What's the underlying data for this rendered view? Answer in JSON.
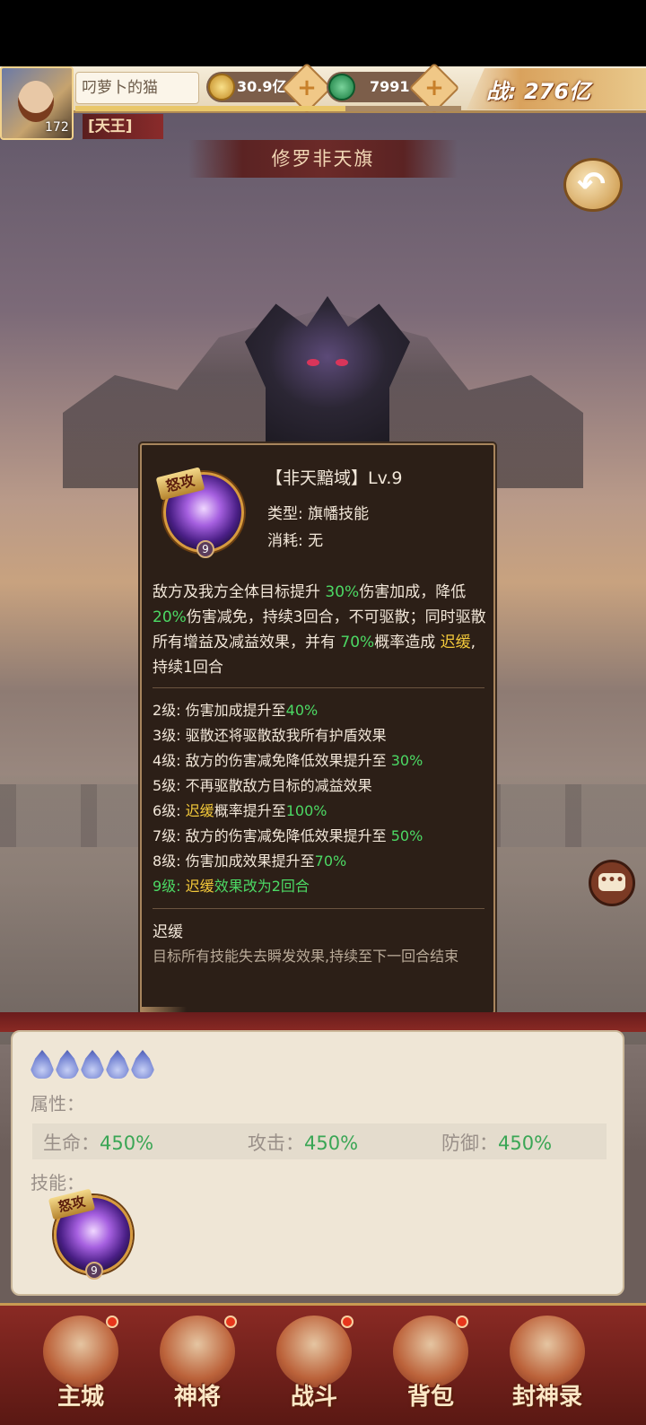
{
  "header": {
    "player_name": "叼萝卜的猫",
    "level": "172",
    "currency": [
      {
        "icon": "coin-icon",
        "value": "30.9亿"
      },
      {
        "icon": "jade-icon",
        "value": "7991"
      }
    ],
    "power": "战: 276亿",
    "rank": "[天王]",
    "exp_fraction": 0.7
  },
  "page_title": "修罗非天旗",
  "tooltip": {
    "badge": "怒攻",
    "skill_level_badge": "9",
    "name": "【非天黯域】Lv.9",
    "type": "类型: 旗幡技能",
    "cost": "消耗: 无",
    "desc": [
      {
        "t": "敌方及我方全体目标提升 ",
        "c": ""
      },
      {
        "t": "30%",
        "c": "g"
      },
      {
        "t": "伤害加成，降低 ",
        "c": ""
      },
      {
        "t": "20%",
        "c": "g"
      },
      {
        "t": "伤害减免，持续3回合，不可驱散；同时驱散所有增益及减益效果，并有 ",
        "c": ""
      },
      {
        "t": "70%",
        "c": "g"
      },
      {
        "t": "概率造成 ",
        "c": ""
      },
      {
        "t": "迟缓",
        "c": "y"
      },
      {
        "t": ",持续1回合",
        "c": ""
      }
    ],
    "levels": [
      [
        {
          "t": "2级: 伤害加成提升至",
          "c": ""
        },
        {
          "t": "40%",
          "c": "g"
        }
      ],
      [
        {
          "t": "3级: 驱散还将驱散敌我所有护盾效果",
          "c": ""
        }
      ],
      [
        {
          "t": "4级: 敌方的伤害减免降低效果提升至 ",
          "c": ""
        },
        {
          "t": "30%",
          "c": "g"
        }
      ],
      [
        {
          "t": "5级: 不再驱散敌方目标的减益效果",
          "c": ""
        }
      ],
      [
        {
          "t": "6级: ",
          "c": ""
        },
        {
          "t": "迟缓",
          "c": "y"
        },
        {
          "t": "概率提升至",
          "c": ""
        },
        {
          "t": "100%",
          "c": "g"
        }
      ],
      [
        {
          "t": "7级: 敌方的伤害减免降低效果提升至 ",
          "c": ""
        },
        {
          "t": "50%",
          "c": "g"
        }
      ],
      [
        {
          "t": "8级: 伤害加成效果提升至",
          "c": ""
        },
        {
          "t": "70%",
          "c": "g"
        }
      ],
      [
        {
          "t": "9级: ",
          "c": "g"
        },
        {
          "t": "迟缓",
          "c": "y"
        },
        {
          "t": "效果改为2回合",
          "c": "g"
        }
      ]
    ],
    "term": "迟缓",
    "term_desc": "目标所有技能失去瞬发效果,持续至下一回合结束"
  },
  "panel": {
    "attr_label": "属性：",
    "attrs": [
      {
        "name": "生命：",
        "value": "450%"
      },
      {
        "name": "攻击：",
        "value": "450%"
      },
      {
        "name": "防御：",
        "value": "450%"
      }
    ],
    "skill_label": "技能：",
    "skill_badge": "怒攻",
    "skill_level": "9",
    "stars": 5
  },
  "nav": [
    {
      "label": "主城",
      "icon": "city-icon"
    },
    {
      "label": "神将",
      "icon": "general-icon"
    },
    {
      "label": "战斗",
      "icon": "battle-icon"
    },
    {
      "label": "背包",
      "icon": "bag-icon"
    },
    {
      "label": "封神录",
      "icon": "book-icon"
    }
  ],
  "colors": {
    "highlight_green": "#4cd964",
    "highlight_yellow": "#f3c93a",
    "nav_red": "#8a2a24"
  }
}
